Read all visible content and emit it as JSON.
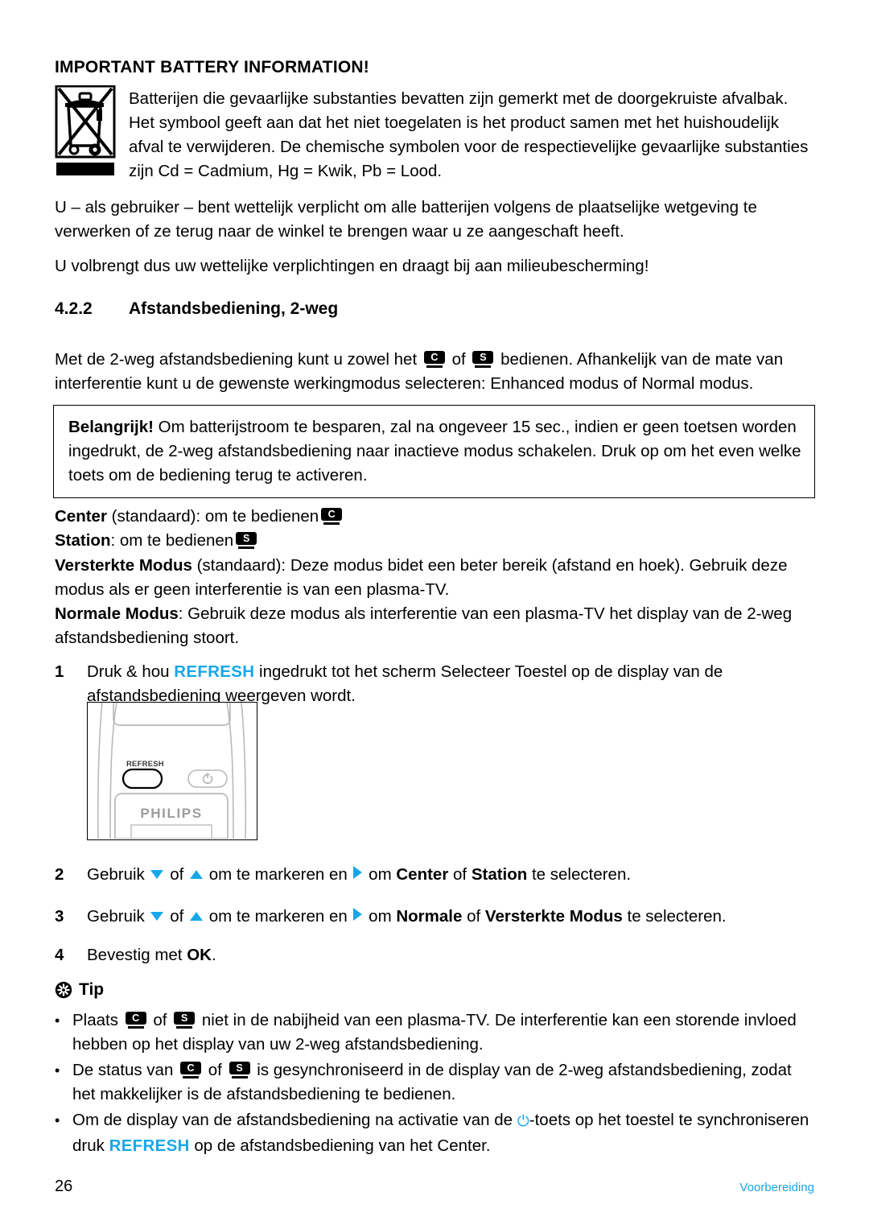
{
  "document": {
    "page_number": "26",
    "footer_section": "Voorbereiding",
    "accent_color": "#18A7E8"
  },
  "battery_section": {
    "heading": "IMPORTANT BATTERY INFORMATION!",
    "icon_name": "crossed-out-wheelie-bin-icon",
    "paragraph_1": "Batterijen die gevaarlijke substanties bevatten zijn gemerkt met de doorgekruiste afvalbak. Het symbool geeft aan dat het niet toegelaten is het product samen met het huishoudelijk afval te verwijderen. De chemische symbolen voor de respectievelijke gevaarlijke substanties zijn Cd = Cadmium, Hg = Kwik, Pb = Lood.",
    "paragraph_2": "U – als gebruiker – bent wettelijk verplicht om alle batterijen volgens de plaatselijke wetgeving te verwerken of ze terug naar de winkel te brengen waar u ze aangeschaft heeft.",
    "paragraph_3": "U volbrengt dus uw wettelijke verplichtingen en draagt bij aan milieubescherming!"
  },
  "section": {
    "number": "4.2.2",
    "title": "Afstandsbediening, 2-weg",
    "intro_1": "Met de 2-weg afstandsbediening kunt u zowel het",
    "intro_2": "of",
    "intro_3": "bedienen. Afhankelijk van de mate van interferentie kunt u de gewenste werkingmodus selecteren: Enhanced modus of Normal modus."
  },
  "important_box": {
    "label": "Belangrijk!",
    "text": "Om batterijstroom te besparen, zal na ongeveer 15 sec., indien er geen toetsen worden ingedrukt, de 2-weg afstandsbediening naar inactieve modus schakelen. Druk op om het even welke toets om de bediening terug te activeren."
  },
  "definitions": [
    {
      "term": "Center",
      "qualifier": " (standaard): om te bedienen",
      "badge": "C",
      "rest": ""
    },
    {
      "term": "Station",
      "qualifier": ": om te bedienen",
      "badge": "S",
      "rest": ""
    },
    {
      "term": "Versterkte Modus",
      "qualifier": " (standaard): Deze modus bidet een beter bereik (afstand en hoek). Gebruik deze modus als er geen interferentie is van een plasma-TV.",
      "badge": "",
      "rest": ""
    },
    {
      "term": "Normale Modus",
      "qualifier": ": Gebruik deze modus als interferentie van een plasma-TV het display van de 2-weg afstandsbediening stoort.",
      "badge": "",
      "rest": ""
    }
  ],
  "steps": {
    "step1": {
      "num": "1",
      "pre": "Druk & hou",
      "keyword": "REFRESH",
      "post": "ingedrukt tot het scherm Selecteer Toestel op de display van de afstandsbediening weergeven wordt."
    },
    "step2": {
      "num": "2",
      "pre": "Gebruik",
      "mid1": "of",
      "mid2": "om te markeren en",
      "mid3": "om",
      "bold1": "Center",
      "conj": "of",
      "bold2": "Station",
      "post": "te selecteren."
    },
    "step3": {
      "num": "3",
      "pre": "Gebruik",
      "mid1": "of",
      "mid2": "om te markeren en",
      "mid3": "om",
      "bold1": "Normale",
      "conj": "of",
      "bold2": "Versterkte Modus",
      "post": "te selecteren."
    },
    "step4": {
      "num": "4",
      "pre": "Bevestig met",
      "bold1": "OK",
      "post": "."
    }
  },
  "device_illustration": {
    "name": "philips-center-device",
    "button_label": "REFRESH",
    "brand": "PHILIPS",
    "power_icon": "power-icon"
  },
  "tip": {
    "icon_name": "tip-asterisk-icon",
    "heading": "Tip",
    "bullets": [
      {
        "pre": "Plaats",
        "badge1": "C",
        "conj": "of",
        "badge2": "S",
        "post": "niet in de nabijheid van een plasma-TV. De interferentie kan een storende invloed hebben op het display van uw 2-weg afstandsbediening."
      },
      {
        "pre": "De status van",
        "badge1": "C",
        "conj": "of",
        "badge2": "S",
        "post": "is gesynchroniseerd in de display van de 2-weg afstandsbediening, zodat het makkelijker is de afstandsbediening te bedienen."
      },
      {
        "pre": "Om de display van de afstandsbediening na activatie van de",
        "power": "⏻",
        "mid": "-toets op het toestel te synchroniseren druk",
        "keyword": "REFRESH",
        "post": "op de afstandsbediening van het Center."
      }
    ]
  }
}
